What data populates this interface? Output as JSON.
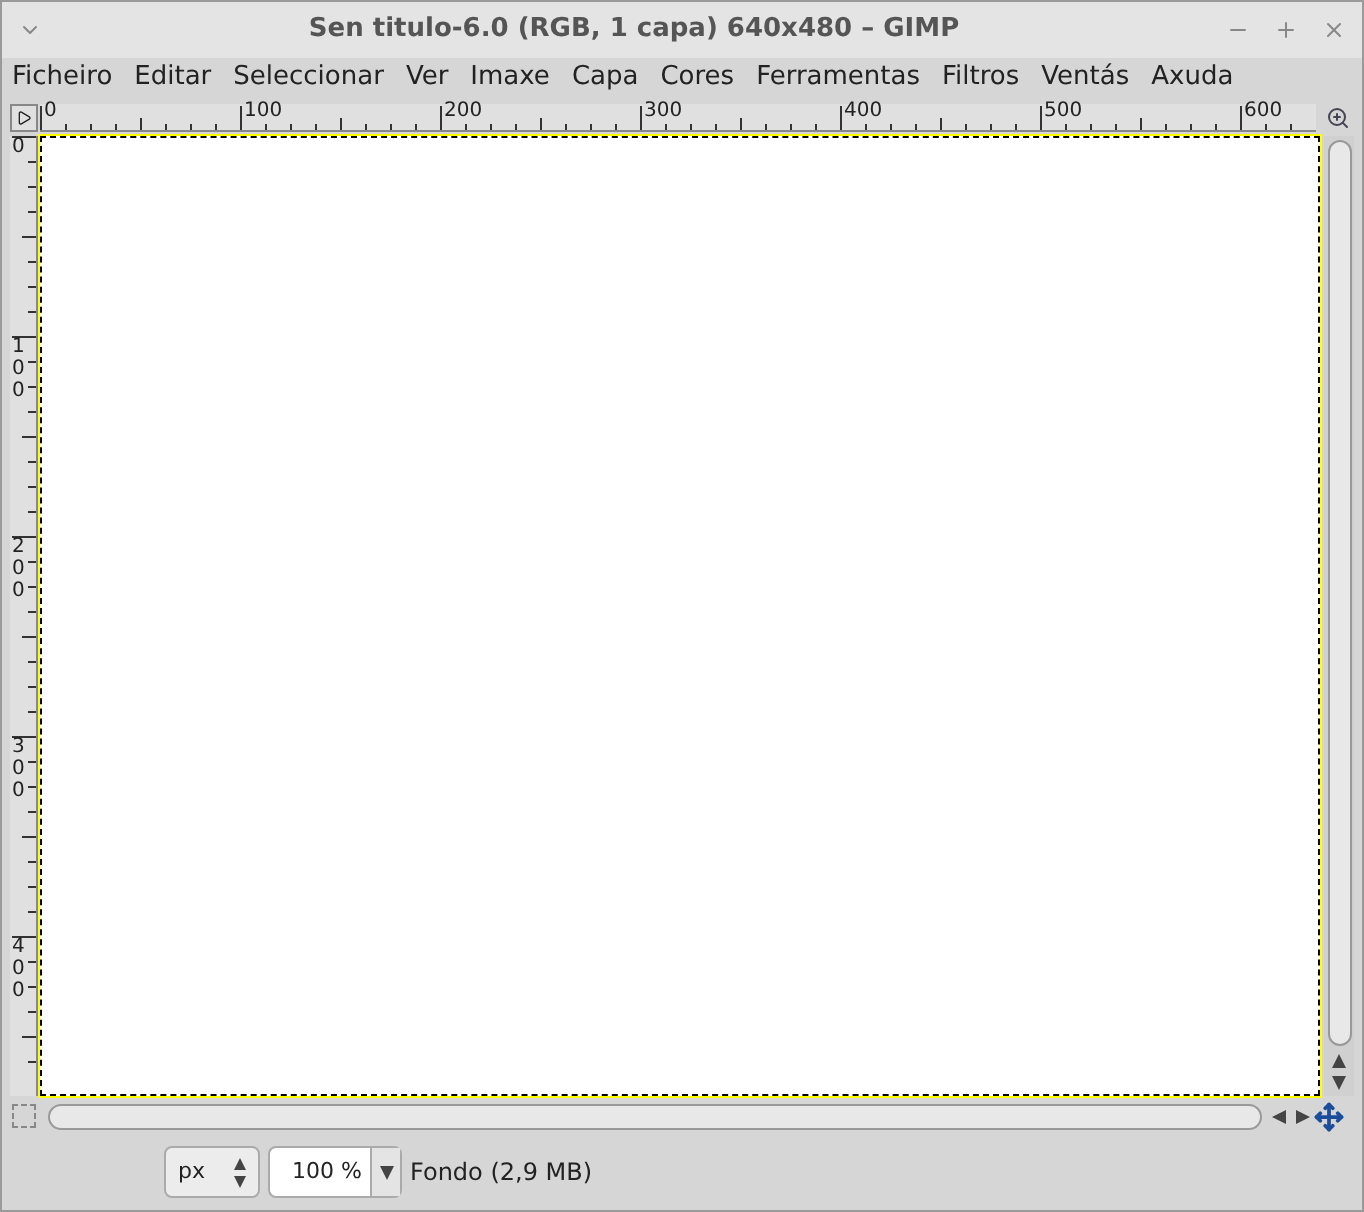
{
  "window": {
    "title": "Sen titulo-6.0 (RGB, 1 capa) 640x480 – GIMP"
  },
  "menu": [
    "Ficheiro",
    "Editar",
    "Seleccionar",
    "Ver",
    "Imaxe",
    "Capa",
    "Cores",
    "Ferramentas",
    "Filtros",
    "Ventás",
    "Axuda"
  ],
  "rulers": {
    "horizontal": [
      "0",
      "100",
      "200",
      "300",
      "400",
      "500",
      "600"
    ],
    "vertical": [
      "0",
      "100",
      "200",
      "300",
      "400"
    ]
  },
  "status_bar": {
    "unit": "px",
    "zoom": "100 %",
    "layer_info": "Fondo (2,9 MB)"
  }
}
